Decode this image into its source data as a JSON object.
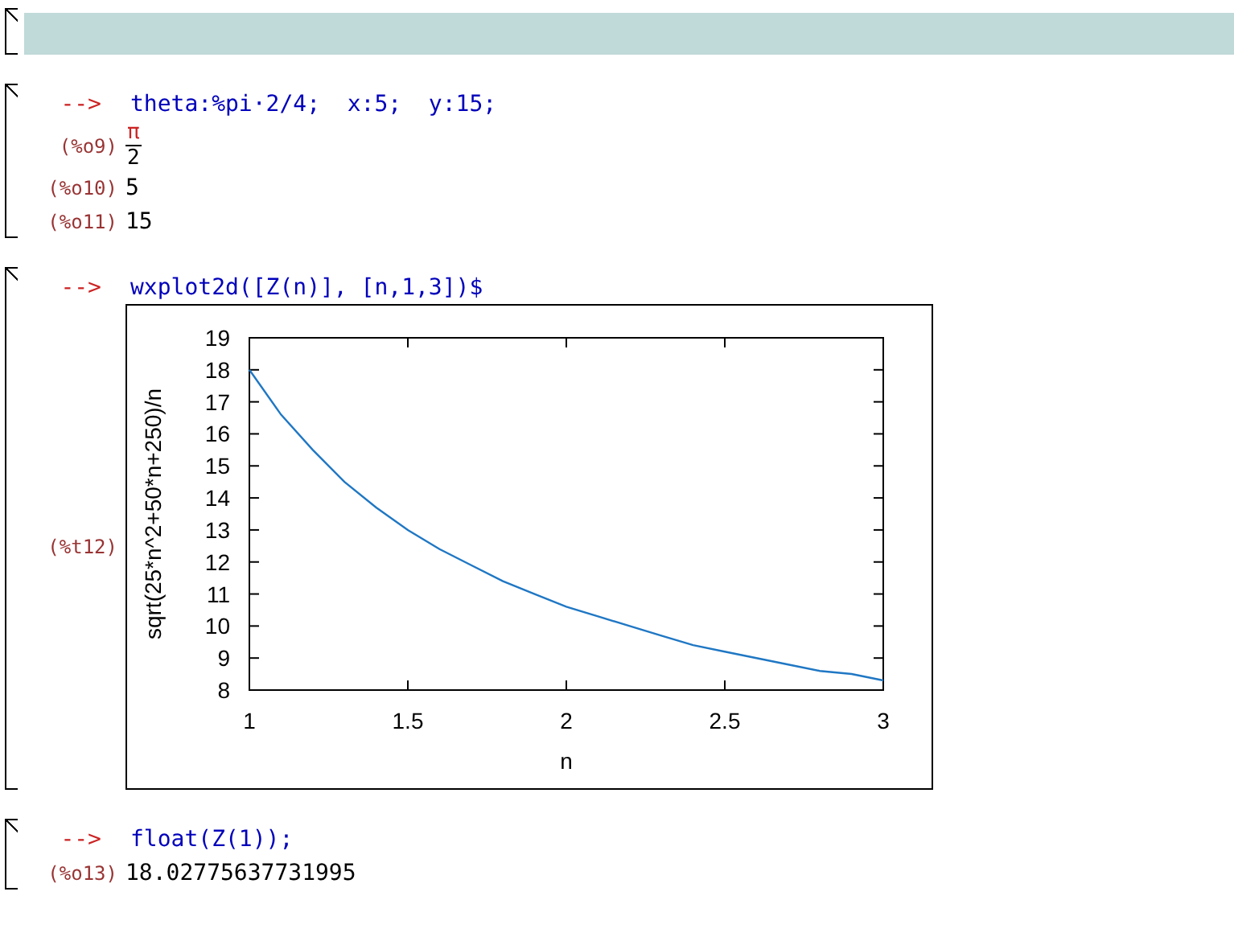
{
  "cells": [
    {
      "kind": "title"
    },
    {
      "kind": "code",
      "prompt": "-->",
      "input": "theta:%pi·2/4;  x:5;  y:15;",
      "outputs": [
        {
          "kind": "fraction",
          "label": "(%o9)",
          "numerator": "π",
          "denominator": "2"
        },
        {
          "kind": "text",
          "label": "(%o10)",
          "value": "5"
        },
        {
          "kind": "text",
          "label": "(%o11)",
          "value": "15"
        }
      ]
    },
    {
      "kind": "code",
      "prompt": "-->",
      "input": "wxplot2d([Z(n)], [n,1,3])$",
      "outputs": [
        {
          "kind": "plot",
          "label": "(%t12)",
          "chart_data": {
            "type": "line",
            "xlabel": "n",
            "ylabel": "sqrt(25*n^2+50*n+250)/n",
            "x": [
              1,
              1.1,
              1.2,
              1.3,
              1.4,
              1.5,
              1.6,
              1.7,
              1.8,
              1.9,
              2,
              2.1,
              2.2,
              2.3,
              2.4,
              2.5,
              2.6,
              2.7,
              2.8,
              2.9,
              3
            ],
            "series": [
              {
                "color": "#1f77c4",
                "values": [
                  18.0,
                  16.6,
                  15.5,
                  14.5,
                  13.7,
                  13.0,
                  12.4,
                  11.9,
                  11.4,
                  11.0,
                  10.6,
                  10.3,
                  10.0,
                  9.7,
                  9.4,
                  9.2,
                  9.0,
                  8.8,
                  8.6,
                  8.5,
                  8.3
                ]
              }
            ],
            "xlim": [
              1,
              3
            ],
            "ylim": [
              8,
              19
            ],
            "xticks": [
              1,
              1.5,
              2,
              2.5,
              3
            ],
            "yticks": [
              8,
              9,
              10,
              11,
              12,
              13,
              14,
              15,
              16,
              17,
              18,
              19
            ]
          }
        }
      ]
    },
    {
      "kind": "code",
      "prompt": "-->",
      "input": "float(Z(1));",
      "outputs": [
        {
          "kind": "text",
          "label": "(%o13)",
          "value": "18.02775637731995"
        }
      ]
    }
  ]
}
